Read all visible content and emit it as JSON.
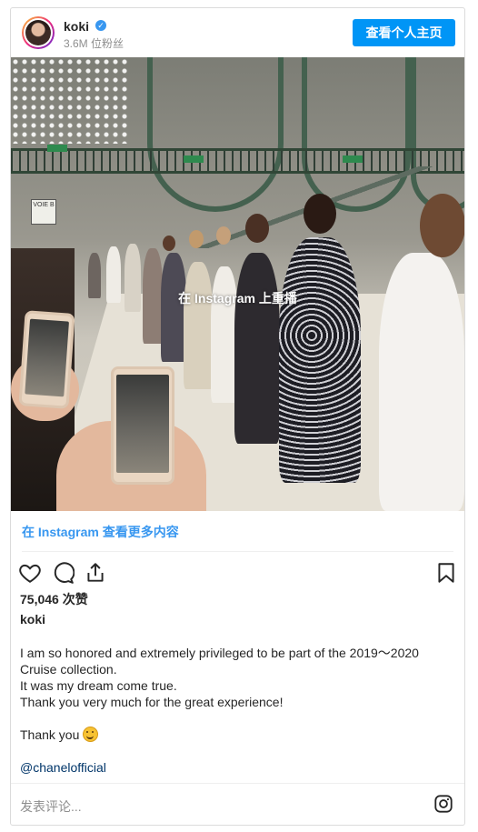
{
  "header": {
    "username": "koki",
    "followers": "3.6M 位粉丝",
    "profile_button": "查看个人主页"
  },
  "media": {
    "overlay_text": "在 Instagram 上重播",
    "signs": {
      "voie": "VOIE B"
    }
  },
  "links": {
    "view_more": "在 Instagram 查看更多内容"
  },
  "stats": {
    "likes": "75,046 次赞"
  },
  "post": {
    "author": "koki",
    "caption_lines": [
      "I am so honored and extremely privileged to be part of the 2019〜2020",
      "Cruise collection.",
      "It was my dream come true.",
      "Thank you very much for the great experience!"
    ],
    "thanks": "Thank you",
    "mention": "@chanelofficial"
  },
  "comment": {
    "placeholder": "发表评论..."
  },
  "icons": {
    "verified": "verified-badge-icon",
    "like": "heart-icon",
    "comment": "comment-bubble-icon",
    "share": "share-icon",
    "save": "bookmark-icon",
    "instagram": "instagram-logo-icon"
  },
  "colors": {
    "accent": "#0095f6",
    "link": "#3897f0",
    "mention": "#003569",
    "border": "#dbdbdb",
    "muted": "#8e8e8e"
  }
}
